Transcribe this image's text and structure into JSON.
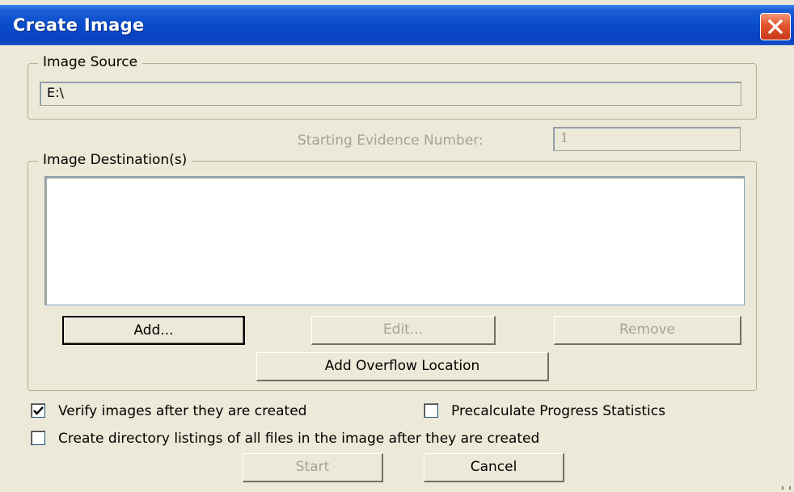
{
  "window": {
    "title": "Create Image"
  },
  "image_source": {
    "legend": "Image Source",
    "value": "E:\\"
  },
  "evidence_number": {
    "label": "Starting Evidence Number:",
    "value": "1"
  },
  "image_destinations": {
    "legend": "Image Destination(s)",
    "items": []
  },
  "buttons": {
    "add": "Add...",
    "edit": "Edit...",
    "remove": "Remove",
    "add_overflow": "Add Overflow Location",
    "start": "Start",
    "cancel": "Cancel"
  },
  "options": {
    "verify": {
      "label": "Verify images after they are created",
      "checked": true
    },
    "precalculate": {
      "label": "Precalculate Progress Statistics",
      "checked": false
    },
    "directory_listings": {
      "label": "Create directory listings of all files in the image after they are created",
      "checked": false
    }
  },
  "colors": {
    "title_bar": "#0a4bc9",
    "dialog_bg": "#ece9d8",
    "close_button": "#e2552d",
    "disabled_text": "#a5a392"
  },
  "icons": {
    "close": "close-x-icon",
    "checkmark": "checkmark-icon"
  }
}
